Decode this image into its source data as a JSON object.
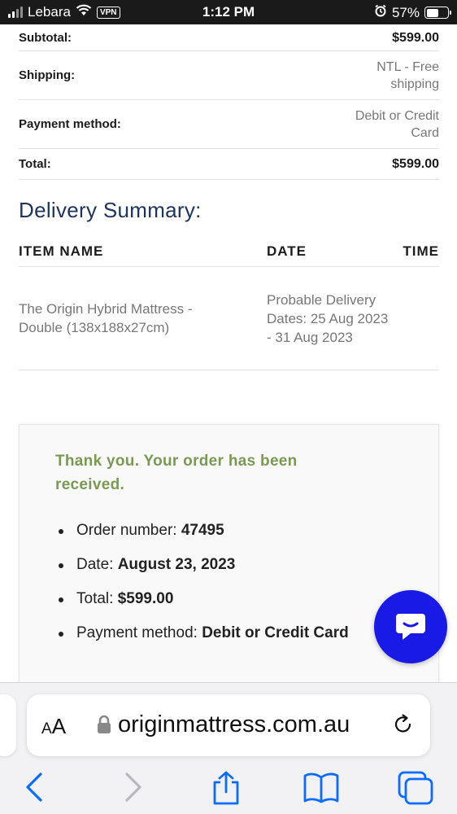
{
  "status_bar": {
    "carrier": "Lebara",
    "vpn": "VPN",
    "time": "1:12 PM",
    "battery": "57%",
    "battery_level": 0.57
  },
  "totals": [
    {
      "label": "Subtotal:",
      "value": "$599.00",
      "strong": true
    },
    {
      "label": "Shipping:",
      "value": "NTL - Free shipping",
      "strong": false
    },
    {
      "label": "Payment method:",
      "value": "Debit or Credit Card",
      "strong": false
    },
    {
      "label": "Total:",
      "value": "$599.00",
      "strong": true
    }
  ],
  "delivery": {
    "title": "Delivery Summary:",
    "headers": {
      "item": "ITEM NAME",
      "date": "DATE",
      "time": "TIME"
    },
    "row": {
      "item": "The Origin Hybrid Mattress - Double (138x188x27cm)",
      "date": "Probable Delivery Dates: 25 Aug 2023 - 31 Aug 2023",
      "time": ""
    }
  },
  "confirmation": {
    "message": "Thank you. Your order has been received.",
    "items": [
      {
        "label": "Order number:",
        "value": "47495"
      },
      {
        "label": "Date:",
        "value": "August 23, 2023"
      },
      {
        "label": "Total:",
        "value": "$599.00"
      },
      {
        "label": "Payment method:",
        "value": "Debit or Credit Card"
      }
    ]
  },
  "browser": {
    "text_size": "AA",
    "url": "originmattress.com.au"
  },
  "colors": {
    "accent_title": "#1d3461",
    "thanks_green": "#7a9a54",
    "chat_blue": "#1a1ae6",
    "ios_blue": "#0a6cff"
  },
  "icons": [
    "wifi-icon",
    "alarm-icon",
    "lock-icon",
    "reload-icon",
    "back-icon",
    "forward-icon",
    "share-icon",
    "bookmarks-icon",
    "tabs-icon",
    "chat-icon"
  ]
}
